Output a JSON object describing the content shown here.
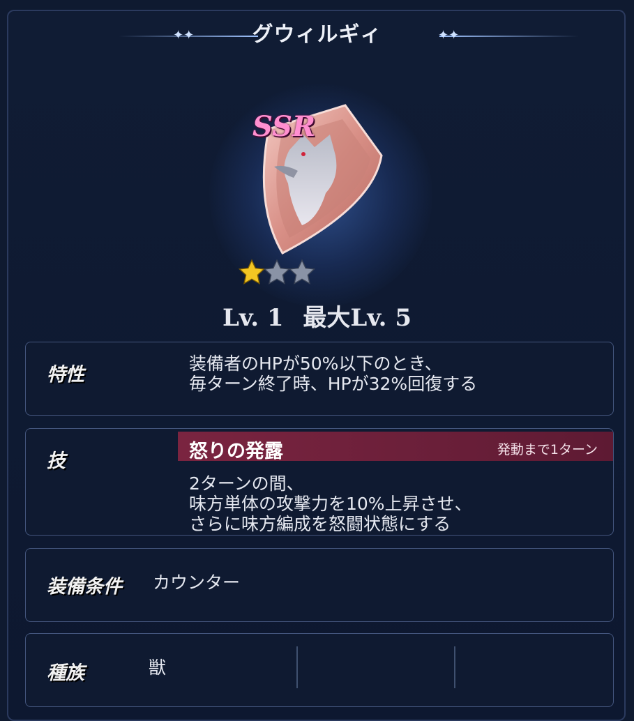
{
  "title": "グウィルギィ",
  "rarity": "SSR",
  "stars": {
    "filled": 1,
    "total": 3
  },
  "level": {
    "current": "Lv. 1",
    "max": "最大Lv. 5"
  },
  "trait": {
    "label": "特性",
    "lines": [
      "装備者のHPが50%以下のとき、",
      "毎ターン終了時、HPが32%回復する"
    ]
  },
  "skill": {
    "label": "技",
    "name": "怒りの発露",
    "timer": "発動まで1ターン",
    "lines": [
      "2ターンの間、",
      "味方単体の攻撃力を10%上昇させ、",
      "さらに味方編成を怒闘状態にする"
    ]
  },
  "equip": {
    "label": "装備条件",
    "value": "カウンター"
  },
  "race": {
    "label": "種族",
    "value": "獣"
  },
  "colors": {
    "skill_bar": "#6a1f39",
    "star_gold": "#f3c623",
    "star_grey": "#8a93a6",
    "ssr_pink": "#ff8fd0"
  }
}
